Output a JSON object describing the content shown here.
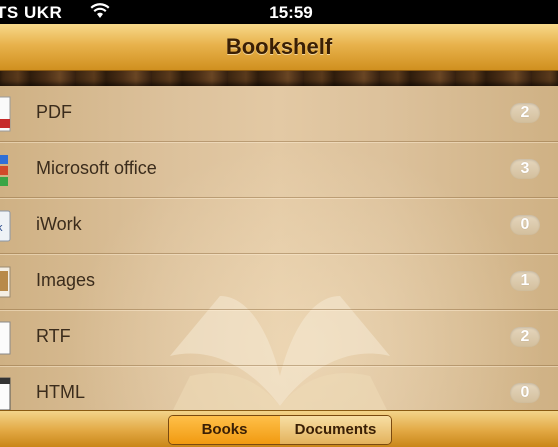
{
  "status_bar": {
    "carrier": "TS UKR",
    "time": "15:59"
  },
  "nav": {
    "title": "Bookshelf"
  },
  "rows": [
    {
      "label": "PDF",
      "count": "2",
      "icon": "pdf-icon"
    },
    {
      "label": "Microsoft office",
      "count": "3",
      "icon": "office-icon"
    },
    {
      "label": "iWork",
      "count": "0",
      "icon": "iwork-icon"
    },
    {
      "label": "Images",
      "count": "1",
      "icon": "images-icon"
    },
    {
      "label": "RTF",
      "count": "2",
      "icon": "rtf-icon"
    },
    {
      "label": "HTML",
      "count": "0",
      "icon": "html-icon"
    }
  ],
  "tabs": {
    "books": "Books",
    "documents": "Documents",
    "selected": "Books"
  },
  "colors": {
    "accent": "#f19a10",
    "text": "#3b2c1c"
  }
}
